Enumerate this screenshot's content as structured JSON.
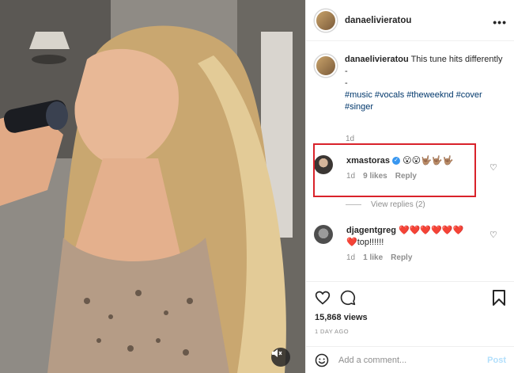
{
  "post": {
    "username": "danaelivieratou",
    "caption": "This tune hits differently",
    "caption_dash1": "-",
    "caption_dash2": "-",
    "hashtags": "#music #vocals #theweeknd #cover #singer",
    "caption_time": "1d"
  },
  "comments": [
    {
      "username": "xmastoras",
      "verified": true,
      "text": "😮😮🤟🏽🤟🏽🤟🏽",
      "time": "1d",
      "likes": "9 likes",
      "reply_label": "Reply",
      "view_replies": "View replies (2)"
    },
    {
      "username": "djagentgreg",
      "text": "❤️❤️❤️❤️❤️❤️",
      "text2": "❤️top!!!!!!",
      "time": "1d",
      "likes": "1 like",
      "reply_label": "Reply"
    }
  ],
  "stats": {
    "views": "15,868 views",
    "posted_ago": "1 DAY AGO"
  },
  "composer": {
    "placeholder": "Add a comment...",
    "post_label": "Post"
  },
  "icons": {
    "more": "more-options-icon",
    "like": "heart-icon",
    "comment": "comment-icon",
    "bookmark": "bookmark-icon",
    "emoji": "emoji-icon",
    "mute": "speaker-muted-icon"
  },
  "colors": {
    "link": "#00376b",
    "highlight_box": "#d9222a",
    "post_disabled": "#b2dffc"
  }
}
